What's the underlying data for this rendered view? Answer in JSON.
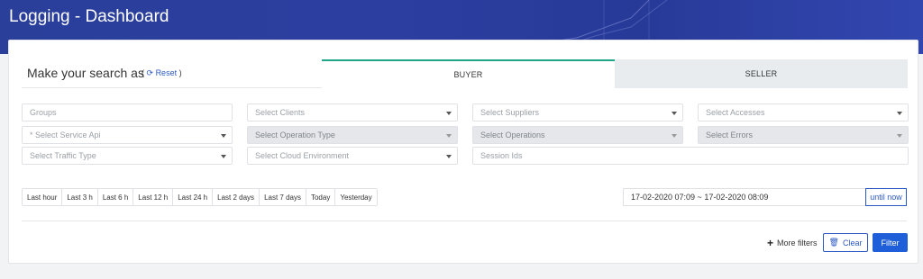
{
  "header": {
    "title": "Logging - Dashboard"
  },
  "search": {
    "title": "Make your search as",
    "reset_open": "( ",
    "reset_label": "Reset",
    "reset_close": " )"
  },
  "tabs": [
    {
      "label": "BUYER",
      "active": true
    },
    {
      "label": "SELLER",
      "active": false
    }
  ],
  "fields": {
    "groups": "Groups",
    "clients": "Select Clients",
    "suppliers": "Select Suppliers",
    "accesses": "Select Accesses",
    "service_api": "* Select Service Api",
    "operation_type": "Select Operation Type",
    "operations": "Select Operations",
    "errors": "Select Errors",
    "traffic_type": "Select Traffic Type",
    "cloud_env": "Select Cloud Environment",
    "session_ids": "Session Ids"
  },
  "ranges": [
    "Last hour",
    "Last 3 h",
    "Last 6 h",
    "Last 12 h",
    "Last 24 h",
    "Last 2 days",
    "Last 7 days",
    "Today",
    "Yesterday"
  ],
  "date_range": {
    "value": "17-02-2020 07:09 ~ 17-02-2020 08:09",
    "until_label": "until now"
  },
  "actions": {
    "more_filters": "More filters",
    "clear": "Clear",
    "filter": "Filter"
  },
  "colors": {
    "header_bg": "#2c3ea0",
    "accent_tab": "#1fa58a",
    "primary": "#1e5ed8",
    "link": "#2b59c3"
  }
}
